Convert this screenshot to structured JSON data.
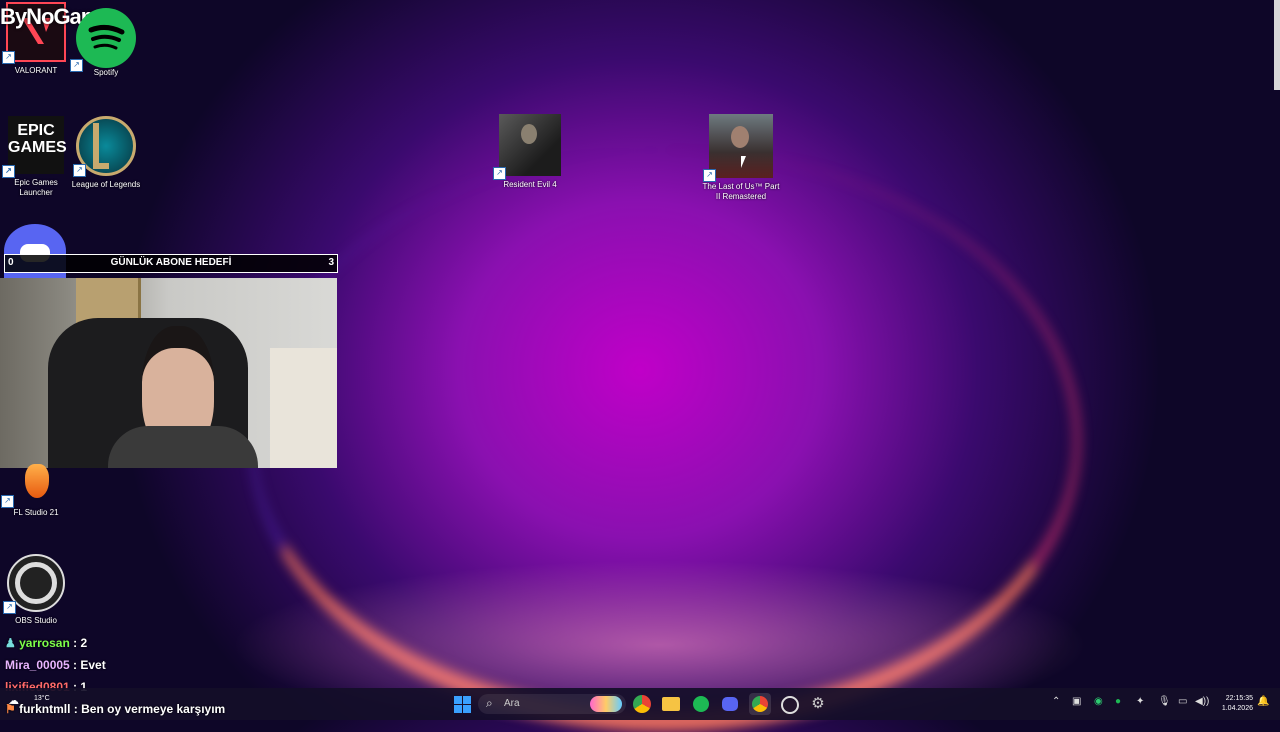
{
  "channel": {
    "brand": "ByNoGame"
  },
  "desktop": {
    "icons": [
      {
        "label": "VALORANT"
      },
      {
        "label": "Spotify"
      },
      {
        "label": "Epic Games Launcher"
      },
      {
        "label": "League of Legends"
      },
      {
        "label": "Resident Evil 4"
      },
      {
        "label": "The Last of Us™ Part II Remastered"
      },
      {
        "label": "FL Studio 21"
      },
      {
        "label": "OBS Studio"
      }
    ],
    "epic_text": "EPIC\nGAMES"
  },
  "overlay": {
    "sub_goal": {
      "current": "0",
      "title": "GÜNLÜK ABONE HEDEFİ",
      "target": "3"
    }
  },
  "chat": [
    {
      "user": "yarrosan",
      "message": " : 2",
      "color": "#7dff4a"
    },
    {
      "user": "Mira_00005",
      "message": " : Evet",
      "color": "#e8b4ff"
    },
    {
      "user": "lixified0801",
      "message": " : 1",
      "color": "#ff6a6a"
    },
    {
      "user": "furkntmll",
      "message": " : Ben oy vermeye karşıyım",
      "color": "#ffffff"
    }
  ],
  "taskbar": {
    "search_placeholder": "Ara",
    "weather": "13°C",
    "time": "22:15:35",
    "date": "1.04.2026"
  },
  "colors": {
    "accent": "#0078d4",
    "spotify": "#1db954",
    "valorant": "#ff4655"
  }
}
